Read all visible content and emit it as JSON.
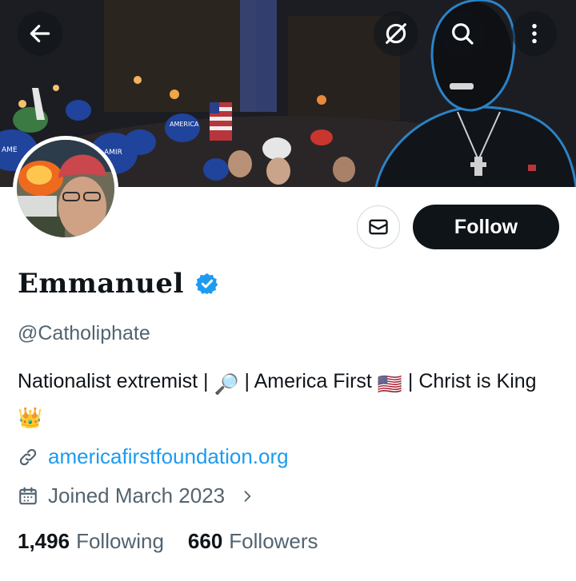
{
  "header": {
    "back_icon": "arrow-left-icon",
    "grok_icon": "slashed-circle-icon",
    "search_icon": "search-icon",
    "more_icon": "more-vertical-icon",
    "banner_sign_text": "AMERICA FIRST"
  },
  "profile": {
    "display_name": "Emmanuel",
    "verified": true,
    "handle": "@Catholiphate",
    "bio_part1": "Nationalist extremist | ",
    "bio_part2": " | America First ",
    "bio_part3": " | Christ is King",
    "bio_flag_emoji": "🇺🇸",
    "bio_crown_emoji": "👑",
    "bio_magnifier_emoji": "🔎",
    "website": "americafirstfoundation.org",
    "joined": "Joined March 2023"
  },
  "actions": {
    "follow_label": "Follow",
    "message_icon": "mail-icon"
  },
  "stats": {
    "following_count": "1,496",
    "following_label": "Following",
    "followers_count": "660",
    "followers_label": "Followers"
  },
  "colors": {
    "link": "#1d9bf0",
    "verified": "#1d9bf0",
    "secondary_text": "#536471",
    "primary_text": "#0f1419"
  }
}
